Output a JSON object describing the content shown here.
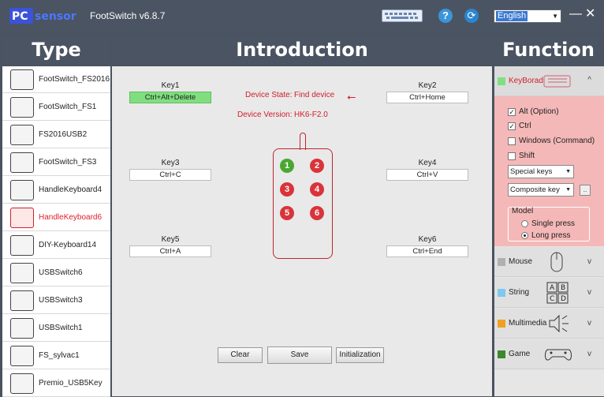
{
  "app": {
    "logo": "PCsensor",
    "title": "FootSwitch v6.8.7",
    "language": "English"
  },
  "headers": {
    "type": "Type",
    "introduction": "Introduction",
    "function": "Function"
  },
  "types": [
    {
      "label": "FootSwitch_FS2016"
    },
    {
      "label": "FootSwitch_FS1"
    },
    {
      "label": "FS2016USB2"
    },
    {
      "label": "FootSwitch_FS3"
    },
    {
      "label": "HandleKeyboard4"
    },
    {
      "label": "HandleKeyboard6"
    },
    {
      "label": "DIY-Keyboard14"
    },
    {
      "label": "USBSwitch6"
    },
    {
      "label": "USBSwitch3"
    },
    {
      "label": "USBSwitch1"
    },
    {
      "label": "FS_sylvac1"
    },
    {
      "label": "Premio_USB5Key"
    }
  ],
  "active_type": "HandleKeyboard6",
  "keys": [
    {
      "label": "Key1",
      "value": "Ctrl+Alt+Delete"
    },
    {
      "label": "Key2",
      "value": "Ctrl+Home"
    },
    {
      "label": "Key3",
      "value": "Ctrl+C"
    },
    {
      "label": "Key4",
      "value": "Ctrl+V"
    },
    {
      "label": "Key5",
      "value": "Ctrl+A"
    },
    {
      "label": "Key6",
      "value": "Ctrl+End"
    }
  ],
  "device": {
    "state_label": "Device State:",
    "state_value": "Find device",
    "version_label": "Device Version:",
    "version_value": "HK6-F2.0",
    "buttons": [
      "1",
      "2",
      "3",
      "4",
      "5",
      "6"
    ]
  },
  "actions": {
    "clear": "Clear",
    "save": "Save",
    "init": "Initialization"
  },
  "functions": {
    "keyboard": {
      "label": "KeyBorad",
      "color": "#80e080",
      "modifiers": [
        {
          "label": "Alt (Option)",
          "checked": true
        },
        {
          "label": "Ctrl",
          "checked": true
        },
        {
          "label": "Windows (Command)",
          "checked": false
        },
        {
          "label": "Shift",
          "checked": false
        }
      ],
      "special_keys": "Special keys",
      "composite_key": "Composite key",
      "more_button": "..",
      "model_title": "Model",
      "single_press": "Single press",
      "long_press": "Long press"
    },
    "mouse": {
      "label": "Mouse",
      "color": "#b0b0b0"
    },
    "string": {
      "label": "String",
      "color": "#7fc8f0",
      "keys": [
        "A",
        "B",
        "C",
        "D"
      ]
    },
    "multimedia": {
      "label": "Multimedia",
      "color": "#f0a020"
    },
    "game": {
      "label": "Game",
      "color": "#3a8a2a"
    }
  }
}
